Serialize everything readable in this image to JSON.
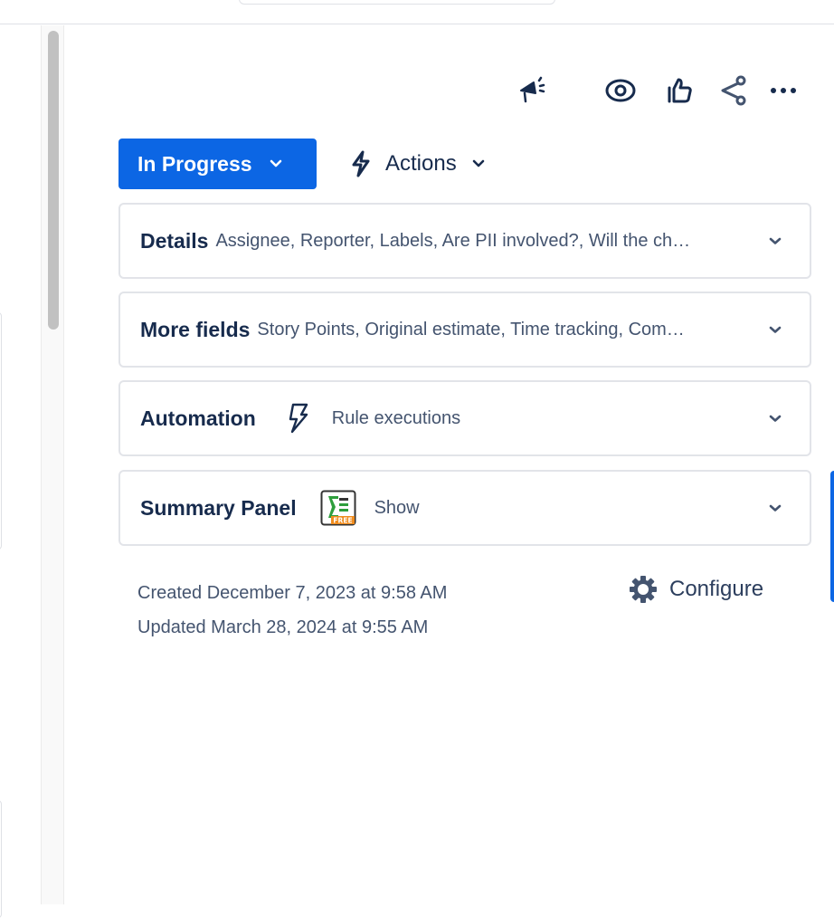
{
  "header_icons": [
    {
      "name": "announce",
      "icon": "megaphone-icon"
    },
    {
      "name": "watch",
      "icon": "eye-icon"
    },
    {
      "name": "vote",
      "icon": "thumbs-up-icon"
    },
    {
      "name": "share",
      "icon": "share-icon"
    },
    {
      "name": "more",
      "icon": "more-horizontal-icon"
    }
  ],
  "status": {
    "label": "In Progress",
    "color": "#0c66e4"
  },
  "actions": {
    "label": "Actions"
  },
  "panels": {
    "details": {
      "title": "Details",
      "summary": "Assignee, Reporter, Labels, Are PII involved?, Will the ch…"
    },
    "more_fields": {
      "title": "More fields",
      "summary": "Story Points, Original estimate, Time tracking, Com…"
    },
    "automation": {
      "title": "Automation",
      "text": "Rule executions"
    },
    "summary_panel": {
      "title": "Summary Panel",
      "badge": "FREE",
      "text": "Show"
    }
  },
  "meta": {
    "created": "Created December 7, 2023 at 9:58 AM",
    "updated": "Updated March 28, 2024 at 9:55 AM"
  },
  "configure": {
    "label": "Configure"
  },
  "colors": {
    "text_primary": "#172b4d",
    "text_subtle": "#44546f",
    "brand_blue": "#0c66e4",
    "border": "#e2e4e9"
  }
}
